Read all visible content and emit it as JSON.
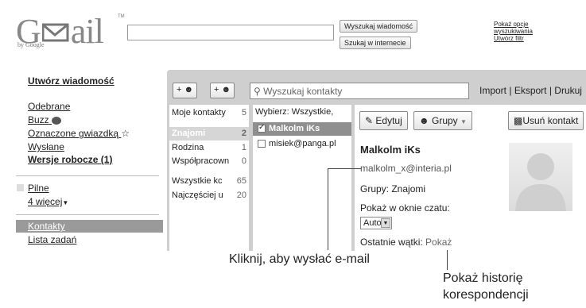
{
  "header": {
    "logo_text": "Gmail",
    "logo_by": "by Google",
    "logo_tm": "TM",
    "search_button": "Wyszukaj wiadomość",
    "web_button": "Szukaj w internecie",
    "options": [
      "Pokaż opcje",
      "wyszukiwania",
      "Utwórz filtr"
    ]
  },
  "nav": {
    "compose": "Utwórz wiadomość",
    "inbox": "Odebrane",
    "buzz": "Buzz",
    "starred": "Oznaczone gwiazdką",
    "sent": "Wysłane",
    "drafts": "Wersje robocze (1)",
    "important": "Pilne",
    "more": "4 więcej",
    "contacts": "Kontakty",
    "tasks": "Lista zadań"
  },
  "toolbar": {
    "add_contact": "+",
    "add_group": "+",
    "search_placeholder": "Wyszukaj kontakty",
    "import": "Import",
    "export": "Eksport",
    "print": "Drukuj"
  },
  "groups": [
    {
      "name": "Moje kontakty",
      "count": "5"
    },
    {
      "name": "Znajomi",
      "count": "2"
    },
    {
      "name": "Rodzina",
      "count": "1"
    },
    {
      "name": "Współpracown",
      "count": "0"
    },
    {
      "name": "Wszystkie kc",
      "count": "65"
    },
    {
      "name": "Najczęściej u",
      "count": "20"
    }
  ],
  "list": {
    "select_label": "Wybierz: Wszystkie,",
    "contacts": [
      {
        "name": "Malkolm iKs",
        "checked": true
      },
      {
        "name": "misiek@panga.pl",
        "checked": false
      }
    ]
  },
  "detail": {
    "edit": "Edytuj",
    "groups_btn": "Grupy",
    "delete": "Usuń kontakt",
    "name": "Malkolm iKs",
    "email": "malkolm_x@interia.pl",
    "groups": "Grupy: Znajomi",
    "chat_label": "Pokaż w oknie czatu:",
    "chat_value": "Auto",
    "threads_label": "Ostatnie wątki:",
    "threads_link": "Pokaż"
  },
  "annotations": {
    "send_mail": "Kliknij, aby wysłać e-mail",
    "history_1": "Pokaż historię",
    "history_2": "korespondencji"
  }
}
